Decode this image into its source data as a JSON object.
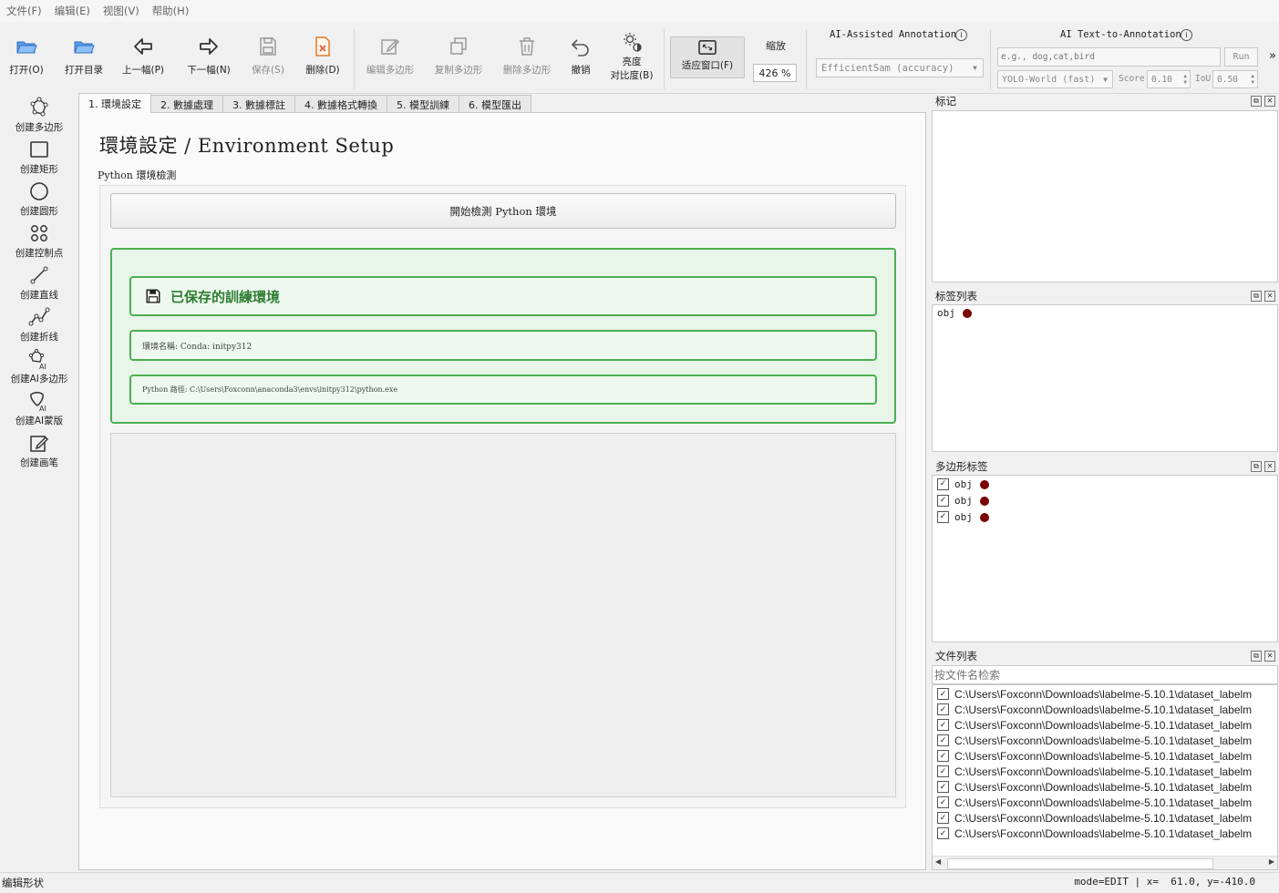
{
  "menu": [
    "文件(F)",
    "编辑(E)",
    "视图(V)",
    "帮助(H)"
  ],
  "toolbar": {
    "open": "打开(O)",
    "open_dir": "打开目录",
    "prev": "上一幅(P)",
    "next": "下一幅(N)",
    "save": "保存(S)",
    "delete": "删除(D)",
    "edit_polygon": "编辑多边形",
    "copy_polygon": "复制多边形",
    "delete_polygon": "删除多边形",
    "undo": "撤销",
    "brightness_1": "亮度",
    "brightness_2": "对比度(B)",
    "fit_window": "适应窗口(F)",
    "zoom_label": "缩放",
    "zoom_value": "426 %",
    "ai_assist_title": "AI-Assisted Annotation",
    "ai_model": "EfficientSam (accuracy)",
    "ai_text_title": "AI Text-to-Annotation",
    "text_prompt_placeholder": "e.g., dog,cat,bird",
    "run_label": "Run",
    "text_model": "YOLO-World (fast)",
    "score_label": "Score",
    "score_value": "0.10",
    "iou_label": "IoU",
    "iou_value": "0.50",
    "more": "»"
  },
  "left_tools": [
    "创建多边形",
    "创建矩形",
    "创建圆形",
    "创建控制点",
    "创建直线",
    "创建折线",
    "创建AI多边形",
    "创建AI蒙版",
    "创建画笔"
  ],
  "tabs": [
    "1. 環境設定",
    "2. 數據處理",
    "3. 數據標註",
    "4. 數據格式轉換",
    "5. 模型訓練",
    "6. 模型匯出"
  ],
  "env": {
    "page_title": "環境設定 / Environment Setup",
    "section_label": "Python 環境檢測",
    "check_button": "開始檢測 Python 環境",
    "saved_title": "已保存的訓練環境",
    "env_name": "環境名稱: Conda: initpy312",
    "python_path": "Python 路徑: C:\\Users\\Foxconn\\anaconda3\\envs\\initpy312\\python.exe"
  },
  "docks": {
    "flags_title": "标记",
    "label_list_title": "标签列表",
    "polygon_labels_title": "多边形标签",
    "file_list_title": "文件列表",
    "file_search_placeholder": "按文件名检索"
  },
  "label_list": [
    "obj"
  ],
  "polygon_labels": [
    "obj",
    "obj",
    "obj"
  ],
  "files": [
    "C:\\Users\\Foxconn\\Downloads\\labelme-5.10.1\\dataset_labelm",
    "C:\\Users\\Foxconn\\Downloads\\labelme-5.10.1\\dataset_labelm",
    "C:\\Users\\Foxconn\\Downloads\\labelme-5.10.1\\dataset_labelm",
    "C:\\Users\\Foxconn\\Downloads\\labelme-5.10.1\\dataset_labelm",
    "C:\\Users\\Foxconn\\Downloads\\labelme-5.10.1\\dataset_labelm",
    "C:\\Users\\Foxconn\\Downloads\\labelme-5.10.1\\dataset_labelm",
    "C:\\Users\\Foxconn\\Downloads\\labelme-5.10.1\\dataset_labelm",
    "C:\\Users\\Foxconn\\Downloads\\labelme-5.10.1\\dataset_labelm",
    "C:\\Users\\Foxconn\\Downloads\\labelme-5.10.1\\dataset_labelm",
    "C:\\Users\\Foxconn\\Downloads\\labelme-5.10.1\\dataset_labelm"
  ],
  "status": {
    "left": "编辑形状",
    "right": "mode=EDIT | x=  61.0, y=-410.0"
  },
  "colors": {
    "label_dot": "#7a0000",
    "success_green": "#4caf50",
    "success_bg": "#e8f5e9",
    "open_icon": "#3b7dd8",
    "delete_icon": "#e07b2a"
  }
}
